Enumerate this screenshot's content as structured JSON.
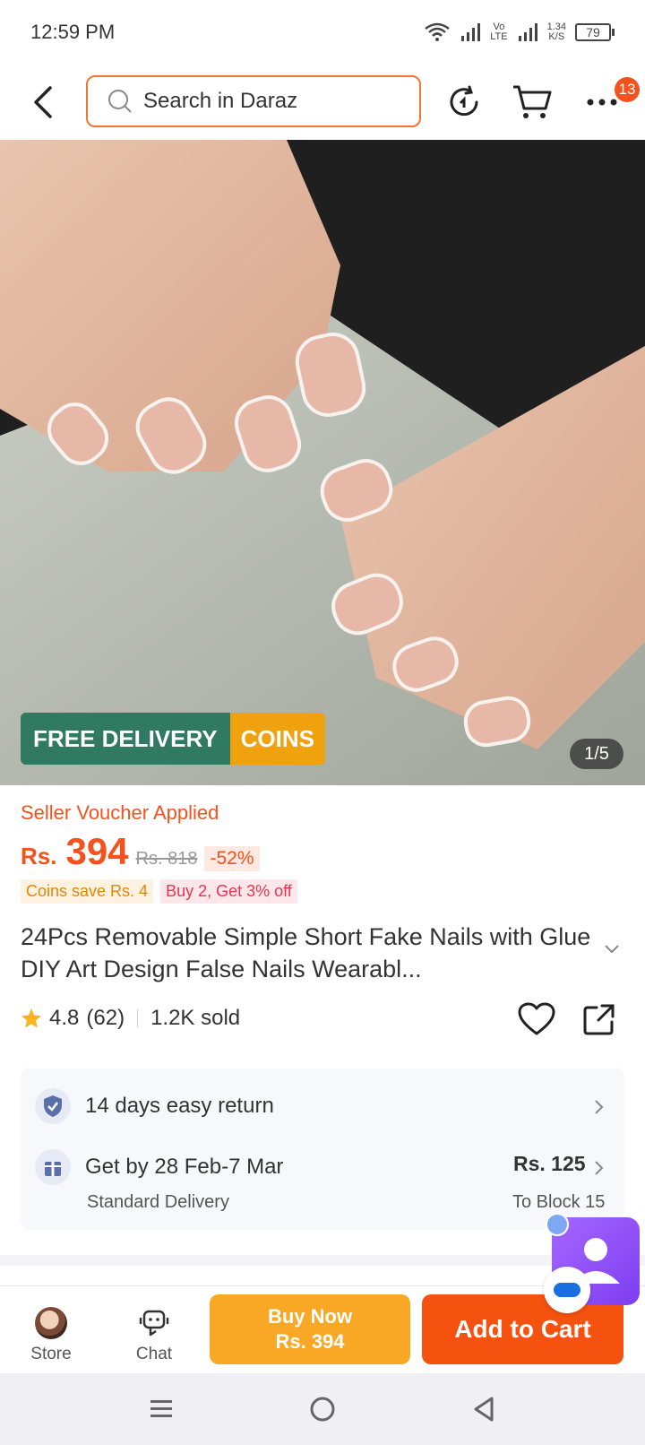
{
  "status_bar": {
    "time": "12:59 PM",
    "network_label_top": "Vo",
    "network_label_bottom": "LTE",
    "speed_value": "1.34",
    "speed_unit": "K/S",
    "battery": "79"
  },
  "header": {
    "search_placeholder": "Search in Daraz",
    "more_badge_count": "13"
  },
  "hero": {
    "badge_free_delivery": "FREE DELIVERY",
    "badge_coins": "COINS",
    "image_counter": "1/5"
  },
  "product": {
    "voucher_text": "Seller Voucher Applied",
    "currency": "Rs.",
    "price": "394",
    "old_price": "Rs. 818",
    "discount": "-52%",
    "promo_coins": "Coins save Rs. 4",
    "promo_buy": "Buy 2, Get 3% off",
    "title": "24Pcs Removable Simple Short   Fake Nails with Glue DIY Art Design False Nails Wearabl...",
    "rating": "4.8",
    "reviews": "(62)",
    "sold": "1.2K sold"
  },
  "services": {
    "return_text": "14 days easy return",
    "delivery_text": "Get by 28 Feb-7 Mar",
    "delivery_sub": "Standard Delivery",
    "delivery_price": "Rs. 125",
    "delivery_to": "To Block 15"
  },
  "bottom_bar": {
    "store_label": "Store",
    "chat_label": "Chat",
    "buy_now_line1": "Buy Now",
    "buy_now_line2": "Rs. 394",
    "add_to_cart": "Add to Cart"
  },
  "colors": {
    "accent_orange": "#f4511e",
    "buy_now": "#f9a825",
    "free_delivery_green": "#2f7a61",
    "coins_yellow": "#f0a20e"
  },
  "icons": [
    "back-icon",
    "search-icon",
    "refresh-icon",
    "cart-icon",
    "more-icon",
    "star-icon",
    "heart-icon",
    "share-icon",
    "shield-check-icon",
    "gift-icon",
    "chevron-right-icon",
    "chevron-down-icon",
    "chat-icon",
    "menu-icon",
    "home-circle-icon",
    "back-triangle-icon"
  ]
}
